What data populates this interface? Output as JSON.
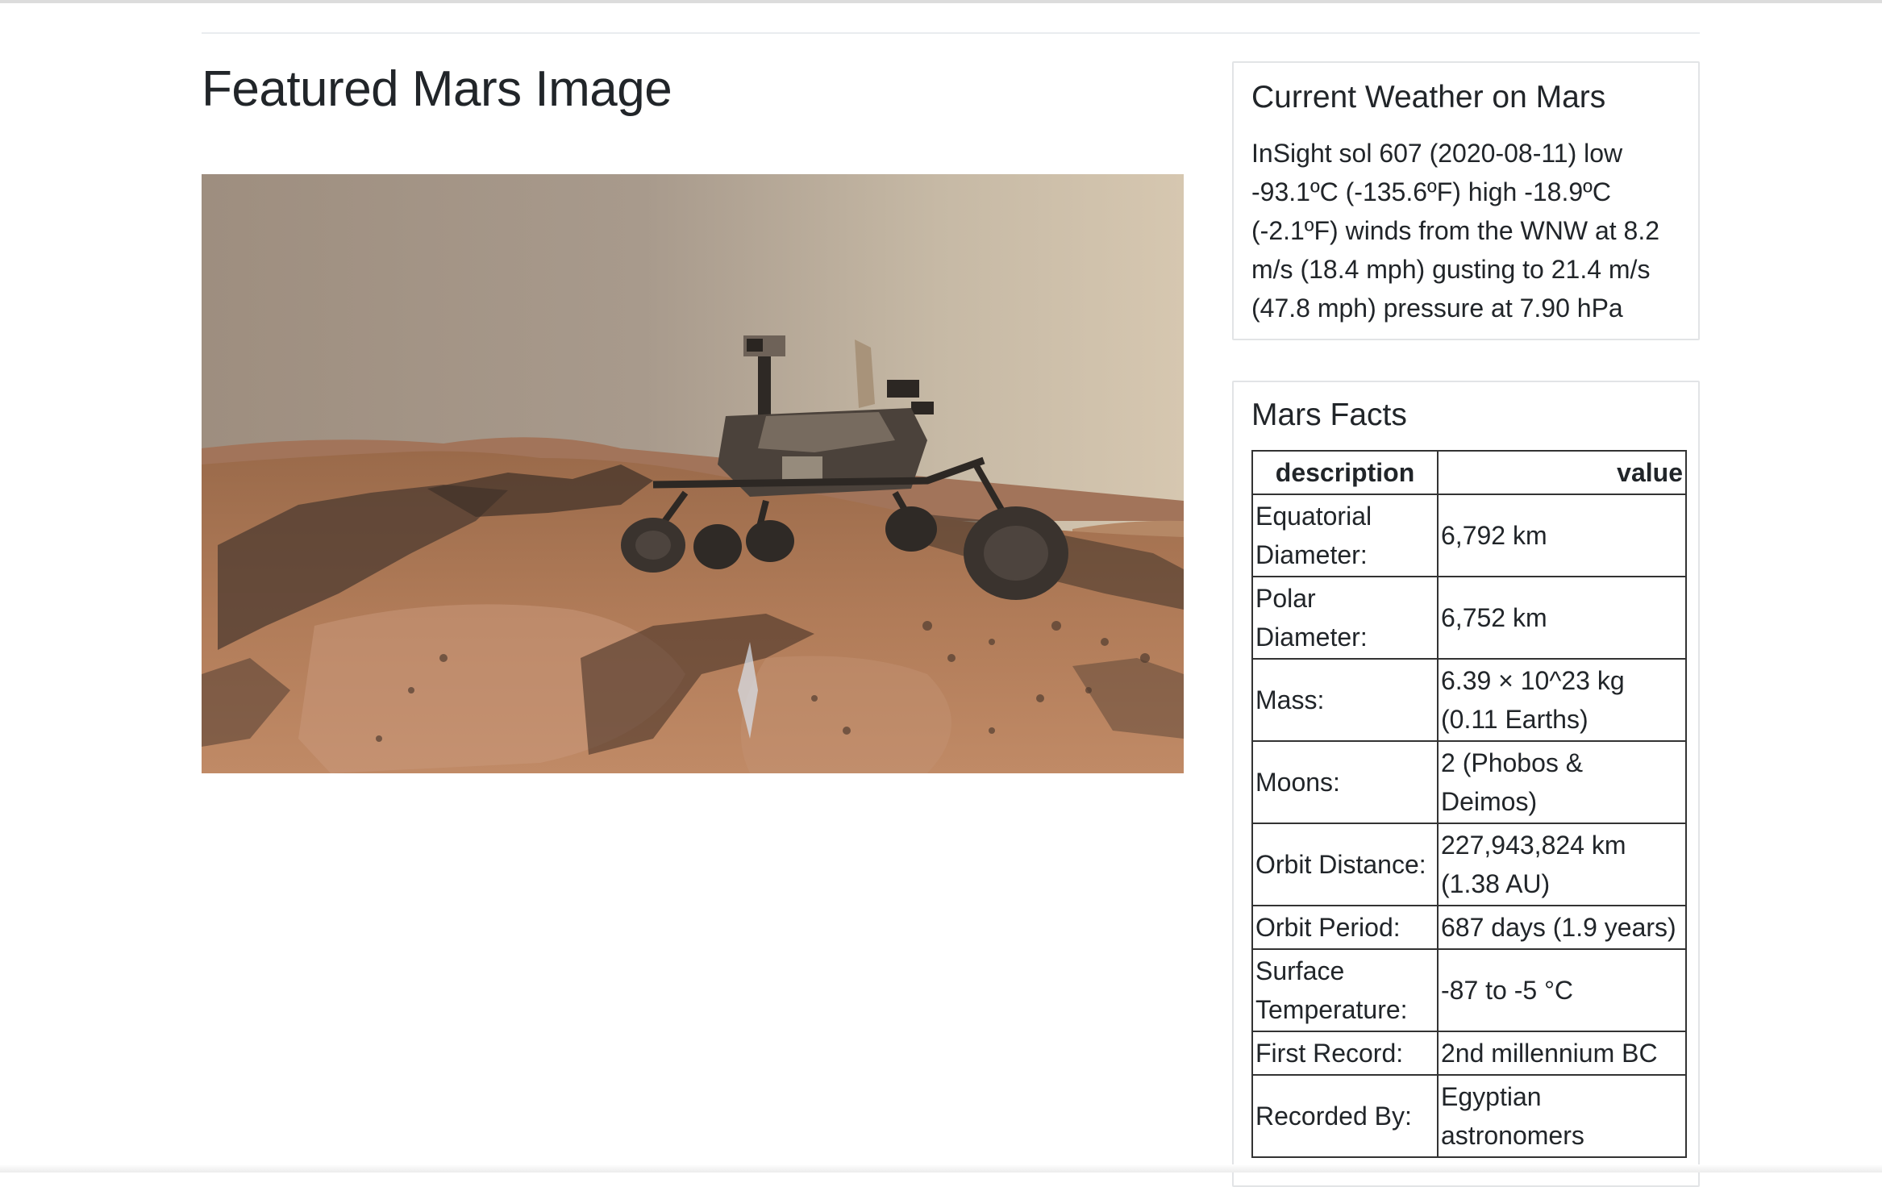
{
  "featured": {
    "title": "Featured Mars Image"
  },
  "weather": {
    "title": "Current Weather on Mars",
    "text": "InSight sol 607 (2020-08-11) low -93.1ºC (-135.6ºF) high -18.9ºC (-2.1ºF) winds from the WNW at 8.2 m/s (18.4 mph) gusting to 21.4 m/s (47.8 mph) pressure at 7.90 hPa"
  },
  "facts": {
    "title": "Mars Facts",
    "headers": [
      "description",
      "value"
    ],
    "rows": [
      {
        "description": "Equatorial Diameter:",
        "value": "6,792 km"
      },
      {
        "description": "Polar Diameter:",
        "value": "6,752 km"
      },
      {
        "description": "Mass:",
        "value": "6.39 × 10^23 kg (0.11 Earths)"
      },
      {
        "description": "Moons:",
        "value": "2 (Phobos & Deimos)"
      },
      {
        "description": "Orbit Distance:",
        "value": "227,943,824 km (1.38 AU)"
      },
      {
        "description": "Orbit Period:",
        "value": "687 days (1.9 years)"
      },
      {
        "description": "Surface Temperature:",
        "value": "-87 to -5 °C"
      },
      {
        "description": "First Record:",
        "value": "2nd millennium BC"
      },
      {
        "description": "Recorded By:",
        "value": "Egyptian astronomers"
      }
    ]
  }
}
